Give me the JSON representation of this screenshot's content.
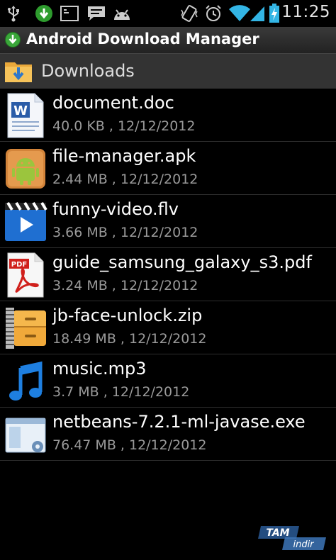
{
  "status_bar": {
    "time": "11:25",
    "icons": [
      "usb-icon",
      "download-notification-icon",
      "screenshot-icon",
      "message-icon",
      "android-debug-icon",
      "vibrate-icon",
      "alarm-icon",
      "wifi-icon",
      "signal-icon",
      "battery-charging-icon"
    ]
  },
  "titlebar": {
    "title": "Android Download Manager"
  },
  "folder": {
    "title": "Downloads"
  },
  "files": [
    {
      "name": "document.doc",
      "meta": "40.0 KB , 12/12/2012",
      "icon": "word-document-icon"
    },
    {
      "name": "file-manager.apk",
      "meta": "2.44 MB , 12/12/2012",
      "icon": "android-package-icon"
    },
    {
      "name": "funny-video.flv",
      "meta": "3.66 MB , 12/12/2012",
      "icon": "video-icon"
    },
    {
      "name": "guide_samsung_galaxy_s3.pdf",
      "meta": "3.24 MB , 12/12/2012",
      "icon": "pdf-icon"
    },
    {
      "name": "jb-face-unlock.zip",
      "meta": "18.49 MB , 12/12/2012",
      "icon": "zip-archive-icon"
    },
    {
      "name": "music.mp3",
      "meta": "3.7 MB , 12/12/2012",
      "icon": "music-note-icon"
    },
    {
      "name": "netbeans-7.2.1-ml-javase.exe",
      "meta": "76.47 MB , 12/12/2012",
      "icon": "executable-icon"
    }
  ],
  "watermark": {
    "line1": "TAM",
    "line2": "indir"
  },
  "colors": {
    "background": "#000000",
    "text": "#ffffff",
    "meta_text": "#9a9a9a",
    "status_accent": "#33b5e5"
  }
}
